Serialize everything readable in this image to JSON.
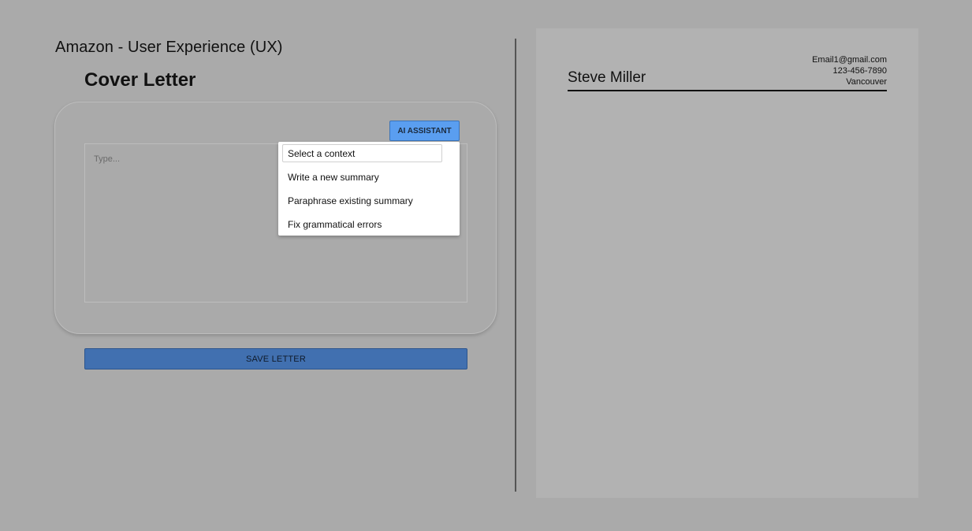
{
  "header": {
    "job_title": "Amazon - User Experience (UX)",
    "section_heading": "Cover Letter"
  },
  "editor": {
    "ai_button_label": "AI ASSISTANT",
    "placeholder": "Type...",
    "dropdown": {
      "select_placeholder": "Select a context",
      "options": [
        "Write a new summary",
        "Paraphrase existing summary",
        "Fix grammatical errors"
      ]
    },
    "save_label": "SAVE LETTER"
  },
  "preview": {
    "name": "Steve Miller",
    "email": "Email1@gmail.com",
    "phone": "123-456-7890",
    "location": "Vancouver"
  }
}
